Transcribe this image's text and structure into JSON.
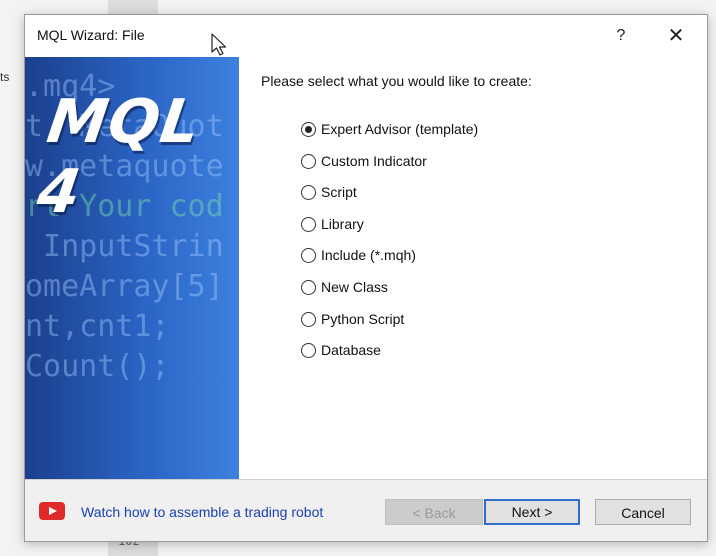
{
  "window": {
    "title": "MQL Wizard: File",
    "help_label": "?",
    "close_label": "✕"
  },
  "banner": {
    "logo_text": "MQL 4",
    "code_lines": [
      ".mq4>",
      "t  MetaQuot",
      "w.metaquote",
      "rt Your cod",
      " InputStrin",
      "",
      "omeArray[5]",
      "nt,cnt1;",
      "",
      "Count();"
    ]
  },
  "content": {
    "prompt": "Please select what you would like to create:",
    "options": [
      {
        "label": "Expert Advisor (template)",
        "selected": true
      },
      {
        "label": "Custom Indicator",
        "selected": false
      },
      {
        "label": "Script",
        "selected": false
      },
      {
        "label": "Library",
        "selected": false
      },
      {
        "label": "Include (*.mqh)",
        "selected": false
      },
      {
        "label": "New Class",
        "selected": false
      },
      {
        "label": "Python Script",
        "selected": false
      },
      {
        "label": "Database",
        "selected": false
      }
    ]
  },
  "footer": {
    "video_link": "Watch how to assemble a trading robot",
    "back_label": "< Back",
    "next_label": "Next >",
    "cancel_label": "Cancel"
  },
  "background": {
    "left_fragment": "ts",
    "line_number": "102"
  },
  "colors": {
    "banner_blue": "#2a64c4",
    "link_blue": "#1a3fb0",
    "youtube_red": "#e02a2a",
    "default_button_border": "#2f6fcf"
  }
}
